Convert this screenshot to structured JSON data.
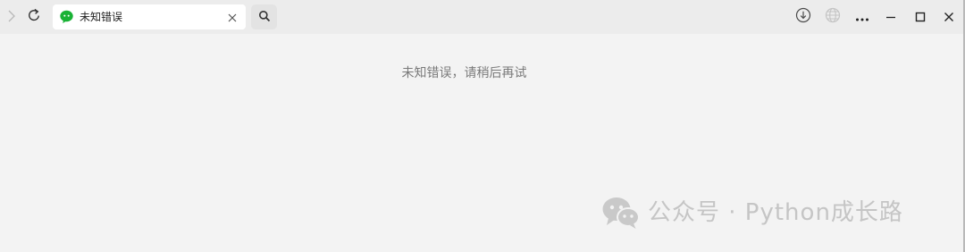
{
  "window": {
    "background": "#f3f3f3"
  },
  "toolbar": {
    "forward_icon": "chevron-right-icon",
    "refresh_icon": "refresh-icon",
    "search_icon": "search-icon"
  },
  "tab": {
    "title": "未知错误",
    "favicon": "wechat-icon",
    "favicon_color": "#19b235",
    "close_icon": "close-icon"
  },
  "window_controls": {
    "download_icon": "download-icon",
    "globe_icon": "globe-icon",
    "more_icon": "more-icon",
    "minimize_icon": "minimize-icon",
    "maximize_icon": "maximize-icon",
    "close_icon": "close-icon"
  },
  "main": {
    "error_message": "未知错误，请稍后再试"
  },
  "watermark": {
    "text": "公众号 · Python成长路",
    "icon": "wechat-logo-icon"
  }
}
